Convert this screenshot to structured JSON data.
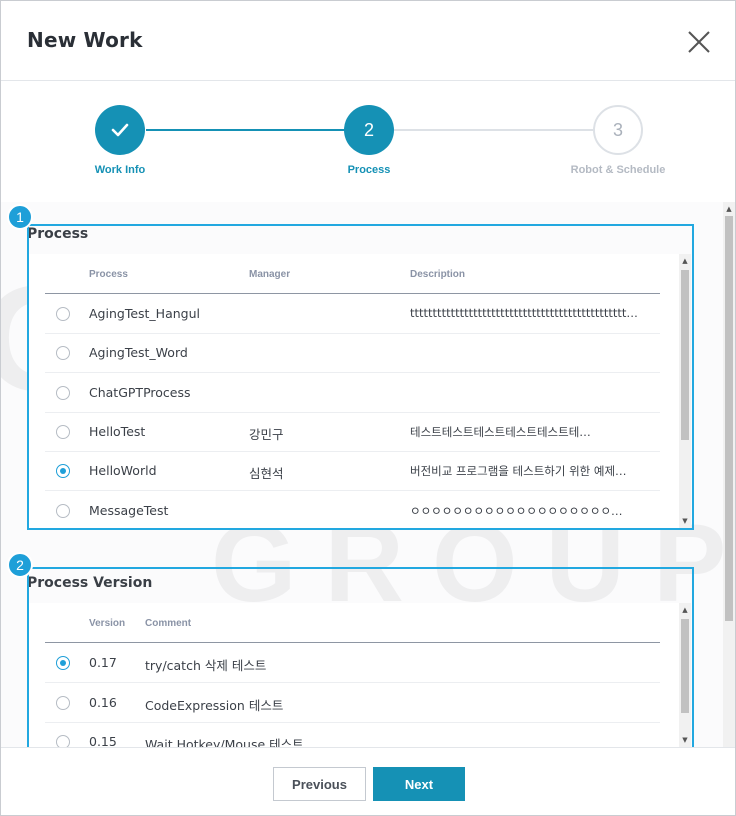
{
  "dialog": {
    "title": "New Work"
  },
  "stepper": {
    "steps": [
      {
        "number": "",
        "label": "Work Info",
        "state": "done"
      },
      {
        "number": "2",
        "label": "Process",
        "state": "active"
      },
      {
        "number": "3",
        "label": "Robot & Schedule",
        "state": "pending"
      }
    ]
  },
  "watermark": {
    "line1": "OSCO",
    "line2": "GROUP"
  },
  "process_section": {
    "badge": "1",
    "title": "Process",
    "columns": [
      "Process",
      "Manager",
      "Description"
    ],
    "rows": [
      {
        "name": "AgingTest_Hangul",
        "manager": "",
        "description": "tttttttttttttttttttttttttttttttttttttttttttttttt…",
        "selected": false
      },
      {
        "name": "AgingTest_Word",
        "manager": "",
        "description": "",
        "selected": false
      },
      {
        "name": "ChatGPTProcess",
        "manager": "",
        "description": "",
        "selected": false
      },
      {
        "name": "HelloTest",
        "manager": "강민구",
        "description": "테스트테스트테스트테스트테스트테…",
        "selected": false
      },
      {
        "name": "HelloWorld",
        "manager": "심현석",
        "description": "버전비교 프로그램을 테스트하기 위한 예제…",
        "selected": true
      },
      {
        "name": "MessageTest",
        "manager": "",
        "description": "ㅇㅇㅇㅇㅇㅇㅇㅇㅇㅇㅇㅇㅇㅇㅇㅇㅇㅇㅇ…",
        "selected": false
      }
    ]
  },
  "version_section": {
    "badge": "2",
    "title": "Process Version",
    "columns": [
      "Version",
      "Comment"
    ],
    "rows": [
      {
        "version": "0.17",
        "comment": "try/catch 삭제 테스트",
        "selected": true
      },
      {
        "version": "0.16",
        "comment": "CodeExpression 테스트",
        "selected": false
      },
      {
        "version": "0.15",
        "comment": "Wait Hotkey/Mouse 테스트",
        "selected": false
      }
    ]
  },
  "footer": {
    "previous_label": "Previous",
    "next_label": "Next"
  },
  "colors": {
    "accent": "#1591b5",
    "highlight": "#22a8e0",
    "badge": "#1e9fd8"
  },
  "icons": {
    "close": "close-icon",
    "check": "check-icon"
  }
}
